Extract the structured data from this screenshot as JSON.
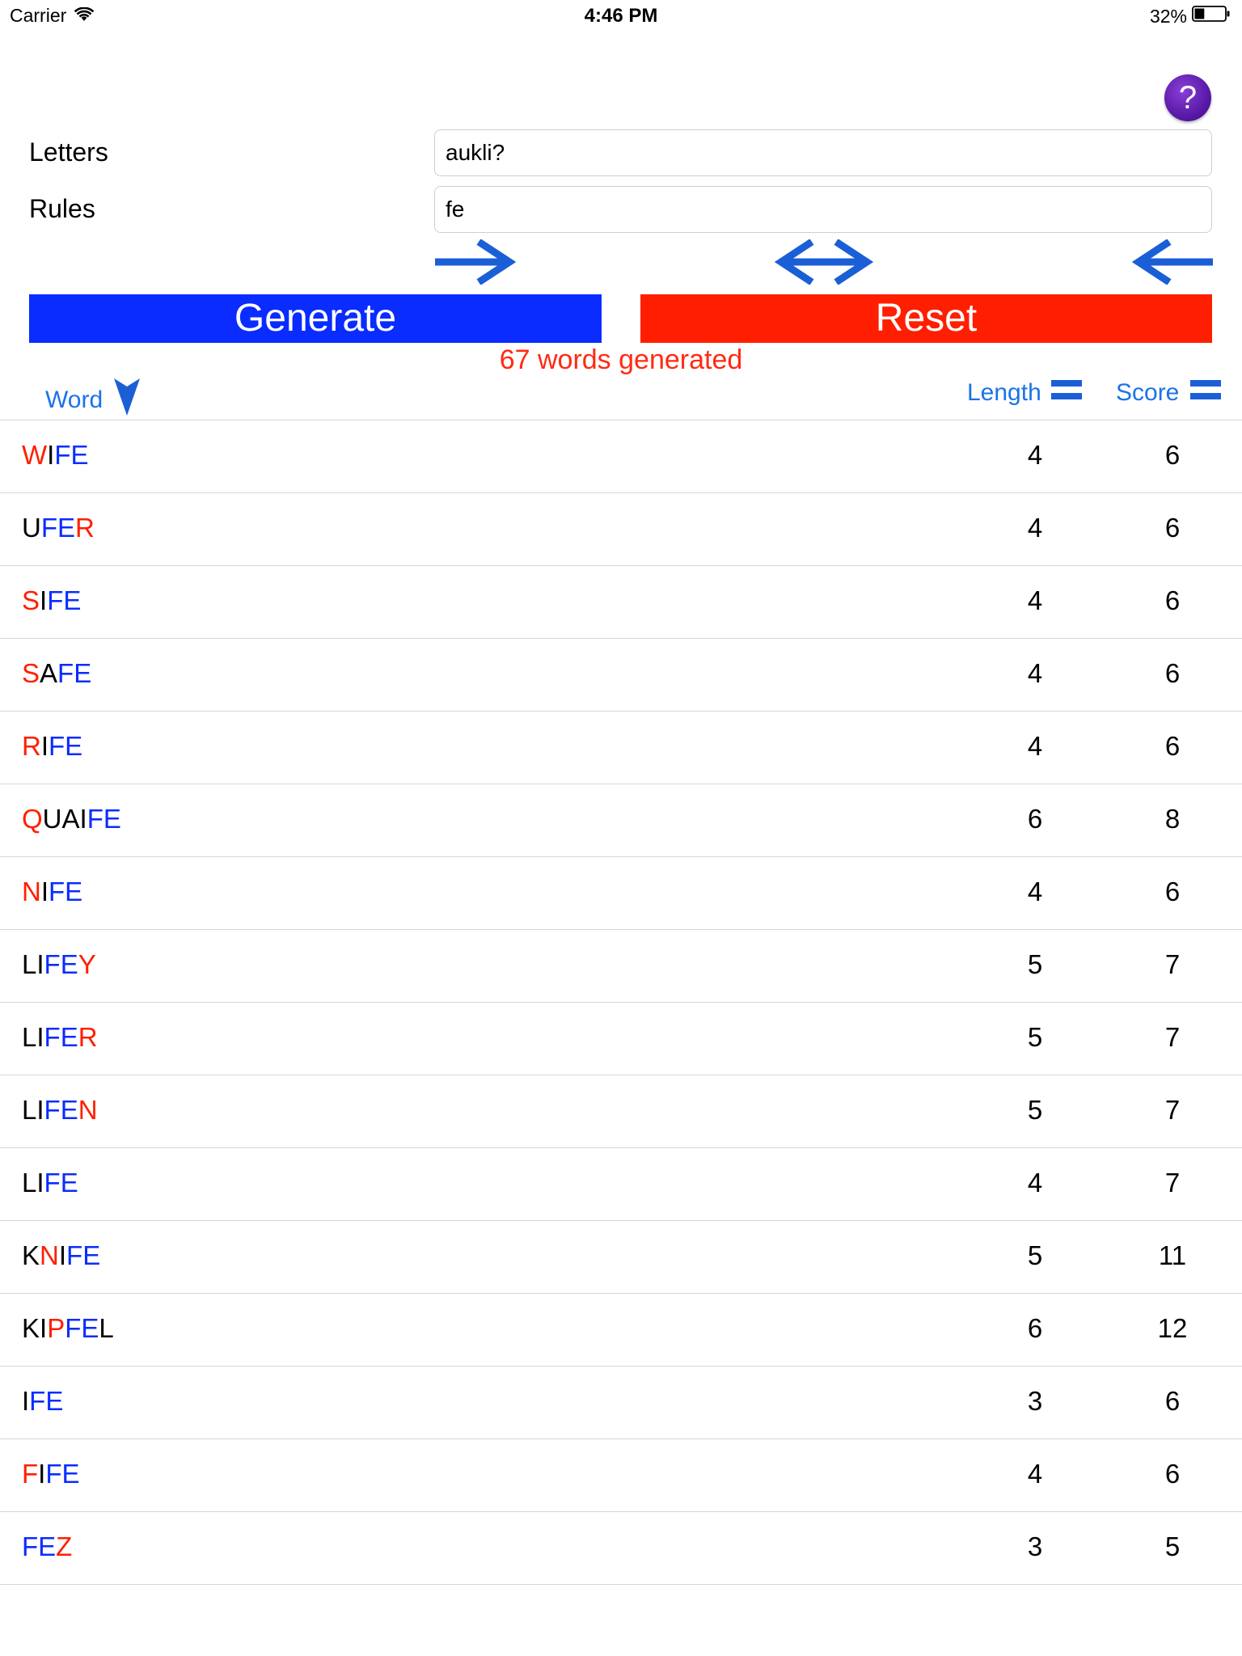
{
  "status_bar": {
    "carrier": "Carrier",
    "time": "4:46 PM",
    "battery": "32%",
    "battery_level": 0.32
  },
  "help": {
    "label": "?"
  },
  "form": {
    "letters_label": "Letters",
    "letters_value": "aukli?",
    "rules_label": "Rules",
    "rules_value": "fe"
  },
  "arrows": [
    "arrow-right-icon",
    "arrow-left-right-icon",
    "arrow-left-icon"
  ],
  "buttons": {
    "generate": "Generate",
    "reset": "Reset"
  },
  "result_message": "67 words generated",
  "columns": {
    "word": "Word",
    "length": "Length",
    "score": "Score"
  },
  "colors": {
    "red": "#ff1f00",
    "blue": "#0a2cff",
    "black": "#000000",
    "header_blue": "#1a73e8"
  },
  "rows": [
    {
      "word": "WIFE",
      "segments": [
        [
          "W",
          "r"
        ],
        [
          "I",
          "k"
        ],
        [
          "FE",
          "b"
        ]
      ],
      "length": "4",
      "score": "6"
    },
    {
      "word": "UFER",
      "segments": [
        [
          "U",
          "k"
        ],
        [
          "FE",
          "b"
        ],
        [
          "R",
          "r"
        ]
      ],
      "length": "4",
      "score": "6"
    },
    {
      "word": "SIFE",
      "segments": [
        [
          "S",
          "r"
        ],
        [
          "I",
          "k"
        ],
        [
          "FE",
          "b"
        ]
      ],
      "length": "4",
      "score": "6"
    },
    {
      "word": "SAFE",
      "segments": [
        [
          "S",
          "r"
        ],
        [
          "A",
          "k"
        ],
        [
          "FE",
          "b"
        ]
      ],
      "length": "4",
      "score": "6"
    },
    {
      "word": "RIFE",
      "segments": [
        [
          "R",
          "r"
        ],
        [
          "I",
          "k"
        ],
        [
          "FE",
          "b"
        ]
      ],
      "length": "4",
      "score": "6"
    },
    {
      "word": "QUAIFE",
      "segments": [
        [
          "Q",
          "r"
        ],
        [
          "UAI",
          "k"
        ],
        [
          "FE",
          "b"
        ]
      ],
      "length": "6",
      "score": "8"
    },
    {
      "word": "NIFE",
      "segments": [
        [
          "N",
          "r"
        ],
        [
          "I",
          "k"
        ],
        [
          "FE",
          "b"
        ]
      ],
      "length": "4",
      "score": "6"
    },
    {
      "word": "LIFEY",
      "segments": [
        [
          "LI",
          "k"
        ],
        [
          "FE",
          "b"
        ],
        [
          "Y",
          "r"
        ]
      ],
      "length": "5",
      "score": "7"
    },
    {
      "word": "LIFER",
      "segments": [
        [
          "LI",
          "k"
        ],
        [
          "FE",
          "b"
        ],
        [
          "R",
          "r"
        ]
      ],
      "length": "5",
      "score": "7"
    },
    {
      "word": "LIFEN",
      "segments": [
        [
          "LI",
          "k"
        ],
        [
          "FE",
          "b"
        ],
        [
          "N",
          "r"
        ]
      ],
      "length": "5",
      "score": "7"
    },
    {
      "word": "LIFE",
      "segments": [
        [
          "LI",
          "k"
        ],
        [
          "FE",
          "b"
        ]
      ],
      "length": "4",
      "score": "7"
    },
    {
      "word": "KNIFE",
      "segments": [
        [
          "K",
          "k"
        ],
        [
          "N",
          "r"
        ],
        [
          "I",
          "k"
        ],
        [
          "FE",
          "b"
        ]
      ],
      "length": "5",
      "score": "11"
    },
    {
      "word": "KIPFEL",
      "segments": [
        [
          "KI",
          "k"
        ],
        [
          "P",
          "r"
        ],
        [
          "FE",
          "b"
        ],
        [
          "L",
          "k"
        ]
      ],
      "length": "6",
      "score": "12"
    },
    {
      "word": "IFE",
      "segments": [
        [
          "I",
          "k"
        ],
        [
          "FE",
          "b"
        ]
      ],
      "length": "3",
      "score": "6"
    },
    {
      "word": "FIFE",
      "segments": [
        [
          "F",
          "r"
        ],
        [
          "I",
          "k"
        ],
        [
          "FE",
          "b"
        ]
      ],
      "length": "4",
      "score": "6"
    },
    {
      "word": "FEZ",
      "segments": [
        [
          "FE",
          "b"
        ],
        [
          "Z",
          "r"
        ]
      ],
      "length": "3",
      "score": "5"
    }
  ]
}
